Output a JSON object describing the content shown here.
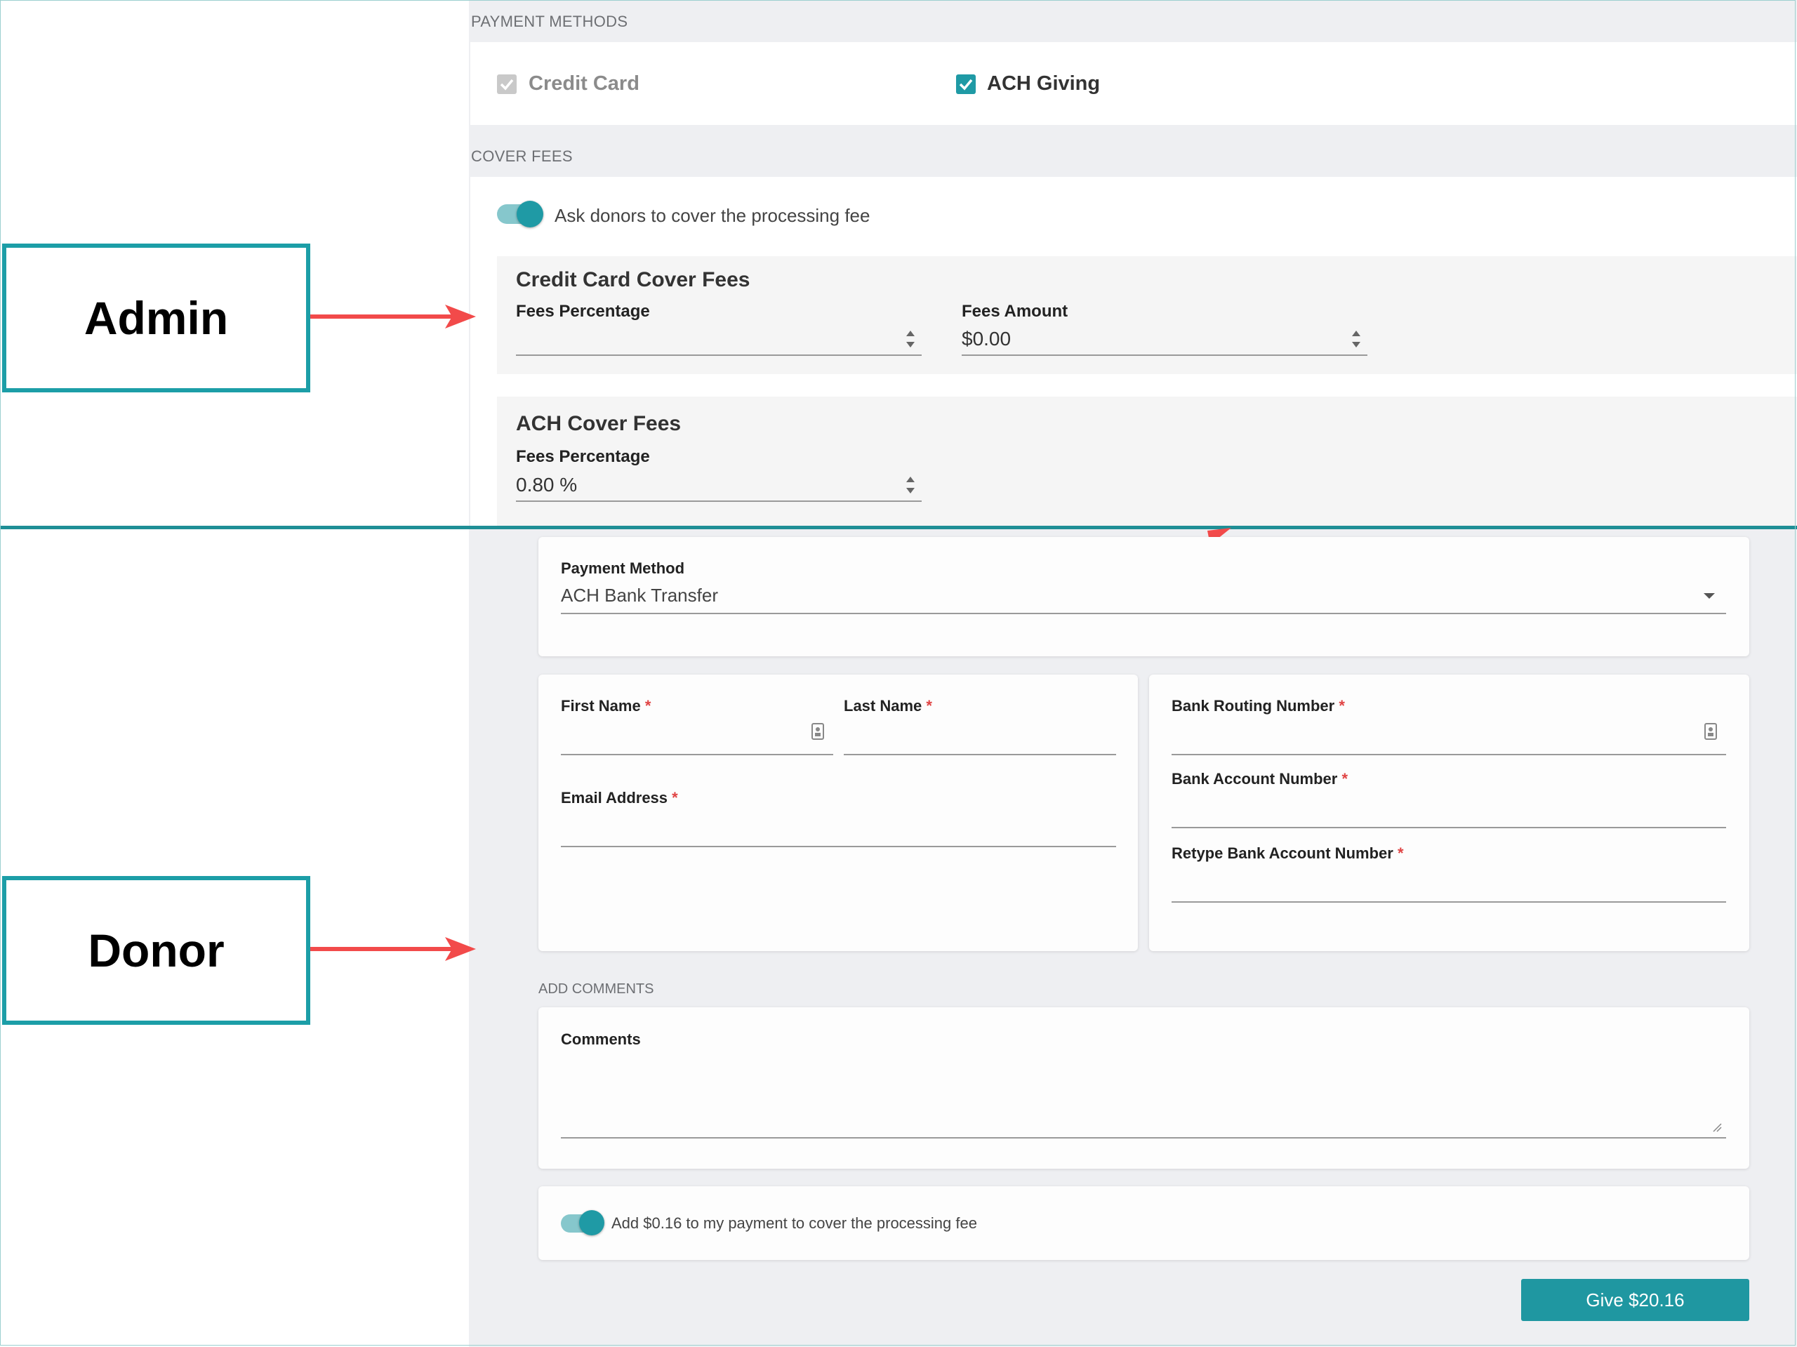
{
  "admin": {
    "payment_methods_label": "PAYMENT METHODS",
    "credit_card_label": "Credit Card",
    "ach_giving_label": "ACH Giving",
    "cover_fees_label": "COVER FEES",
    "ask_donors_label": "Ask donors to cover the processing fee",
    "credit_card_cover_fees": {
      "title": "Credit Card Cover Fees",
      "fees_percentage_label": "Fees Percentage",
      "fees_percentage_value": "",
      "fees_amount_label": "Fees Amount",
      "fees_amount_value": "$0.00"
    },
    "ach_cover_fees": {
      "title": "ACH Cover Fees",
      "fees_percentage_label": "Fees Percentage",
      "fees_percentage_value": "0.80 %"
    }
  },
  "donor": {
    "payment_method_label": "Payment Method",
    "payment_method_value": "ACH Bank Transfer",
    "first_name_label": "First Name",
    "last_name_label": "Last Name",
    "email_label": "Email Address",
    "routing_label": "Bank Routing Number",
    "account_label": "Bank Account Number",
    "retype_account_label": "Retype Bank Account Number",
    "required_mark": "*",
    "add_comments_label": "ADD COMMENTS",
    "comments_label": "Comments",
    "cover_fee_toggle_label": "Add $0.16 to my payment to cover the processing fee",
    "give_button_label": "Give $20.16"
  },
  "annotations": {
    "admin_label": "Admin",
    "donor_label": "Donor"
  },
  "colors": {
    "accent": "#1f9aa5",
    "arrow": "#f24a4a",
    "panel_bg": "#eeeff2"
  },
  "icons": {
    "checkbox": "check-icon",
    "spinner": "spinner-icon",
    "dropdown": "caret-down-icon",
    "contact_card": "contact-card-icon",
    "resize": "resize-handle-icon"
  }
}
